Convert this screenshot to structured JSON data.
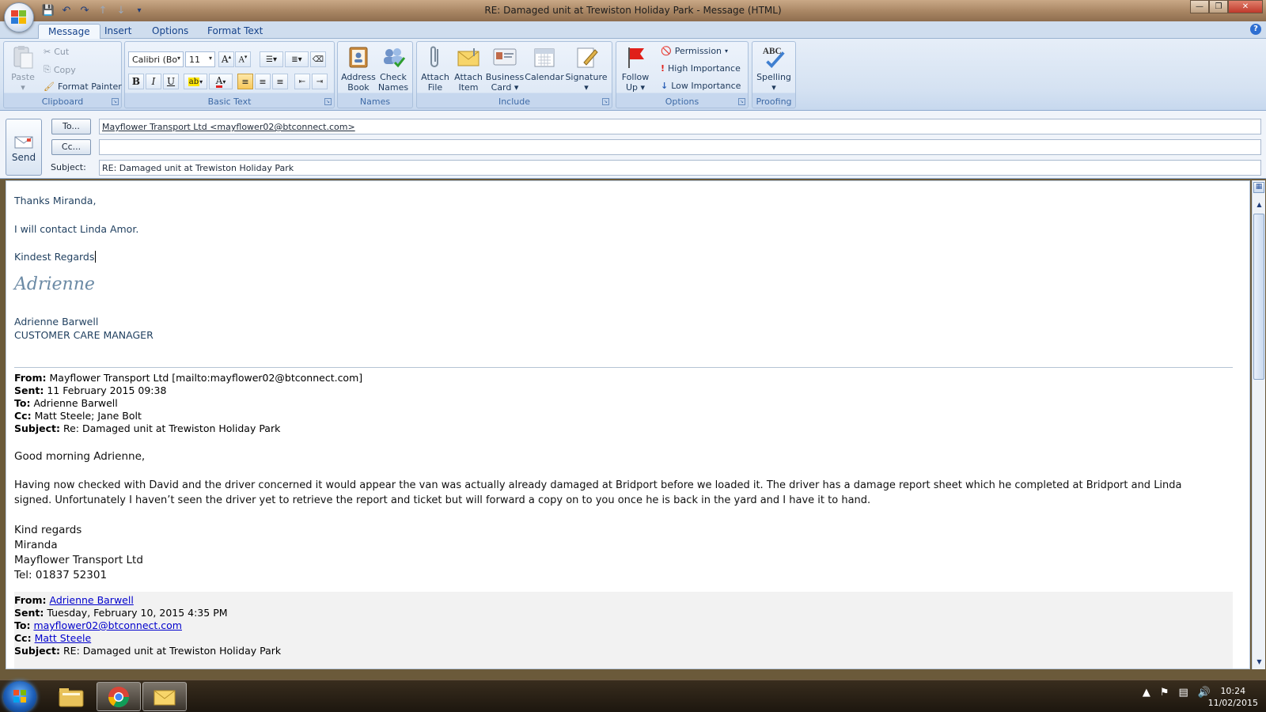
{
  "window": {
    "title": "RE: Damaged unit at Trewiston Holiday Park - Message (HTML)",
    "controls": {
      "minimize": "—",
      "maximize": "❐",
      "close": "✕"
    }
  },
  "qat": {
    "save": "💾",
    "undo": "↶",
    "redo": "↷",
    "prev": "↑",
    "next": "↓",
    "customize": "▾"
  },
  "tabs": [
    "Message",
    "Insert",
    "Options",
    "Format Text"
  ],
  "help": "?",
  "ribbon": {
    "clipboard": {
      "label": "Clipboard",
      "paste": "Paste",
      "cut": "Cut",
      "copy": "Copy",
      "format_painter": "Format Painter"
    },
    "basic_text": {
      "label": "Basic Text",
      "font": "Calibri (Bo",
      "size": "11",
      "bold": "B",
      "italic": "I",
      "underline": "U"
    },
    "names": {
      "label": "Names",
      "address_book": [
        "Address",
        "Book"
      ],
      "check_names": [
        "Check",
        "Names"
      ]
    },
    "include": {
      "label": "Include",
      "attach_file": [
        "Attach",
        "File"
      ],
      "attach_item": [
        "Attach",
        "Item"
      ],
      "business_card": [
        "Business",
        "Card ▾"
      ],
      "calendar": "Calendar",
      "signature": "Signature"
    },
    "options": {
      "label": "Options",
      "follow_up": [
        "Follow",
        "Up ▾"
      ],
      "permission": "Permission",
      "high_importance": "High Importance",
      "low_importance": "Low Importance"
    },
    "proofing": {
      "label": "Proofing",
      "spelling": "Spelling",
      "abc": "ABC"
    }
  },
  "header": {
    "send": "Send",
    "to_button": "To...",
    "cc_button": "Cc...",
    "subject_label": "Subject:",
    "to_value": "Mayflower Transport Ltd <mayflower02@btconnect.com>",
    "cc_value": "",
    "subject_value": "RE: Damaged unit at Trewiston Holiday Park"
  },
  "body": {
    "greeting": "Thanks Miranda,",
    "line1": "I will contact Linda Amor.",
    "closing": "Kindest Regards",
    "signature_script": "Adrienne",
    "sig_name": "Adrienne Barwell",
    "sig_title": "CUSTOMER CARE MANAGER",
    "quote1": {
      "from_label": "From:",
      "from": "Mayflower Transport Ltd [mailto:mayflower02@btconnect.com]",
      "sent_label": "Sent:",
      "sent": "11 February 2015 09:38",
      "to_label": "To:",
      "to": "Adrienne Barwell",
      "cc_label": "Cc:",
      "cc": "Matt Steele; Jane Bolt",
      "subject_label": "Subject:",
      "subject": "Re: Damaged unit at Trewiston Holiday Park",
      "greeting": "Good morning Adrienne,",
      "para_line1": "Having now checked with David and the driver concerned it would appear the van was actually already damaged at Bridport before we loaded it.  The driver has a damage report sheet which he completed at Bridport and Linda",
      "para_line2": "signed.  Unfortunately I haven’t seen the driver yet to retrieve the report and ticket but will forward a copy on to you once he is back in the yard and I have it to hand.",
      "regards": "Kind regards",
      "name": "Miranda",
      "company": "Mayflower Transport Ltd",
      "tel": "Tel: 01837 52301"
    },
    "quote2": {
      "from_label": "From:",
      "from": "Adrienne Barwell",
      "sent_label": "Sent:",
      "sent": "Tuesday, February 10, 2015 4:35 PM",
      "to_label": "To:",
      "to": "mayflower02@btconnect.com",
      "cc_label": "Cc:",
      "cc": "Matt Steele",
      "subject_label": "Subject:",
      "subject": "RE: Damaged unit at Trewiston Holiday Park"
    }
  },
  "taskbar": {
    "time": "10:24",
    "date": "11/02/2015"
  },
  "colors": {
    "ribbon_blue": "#d5e2f2",
    "label_blue": "#3e6aa6",
    "body_text": "#1f3f5f",
    "link": "#0000cc"
  }
}
